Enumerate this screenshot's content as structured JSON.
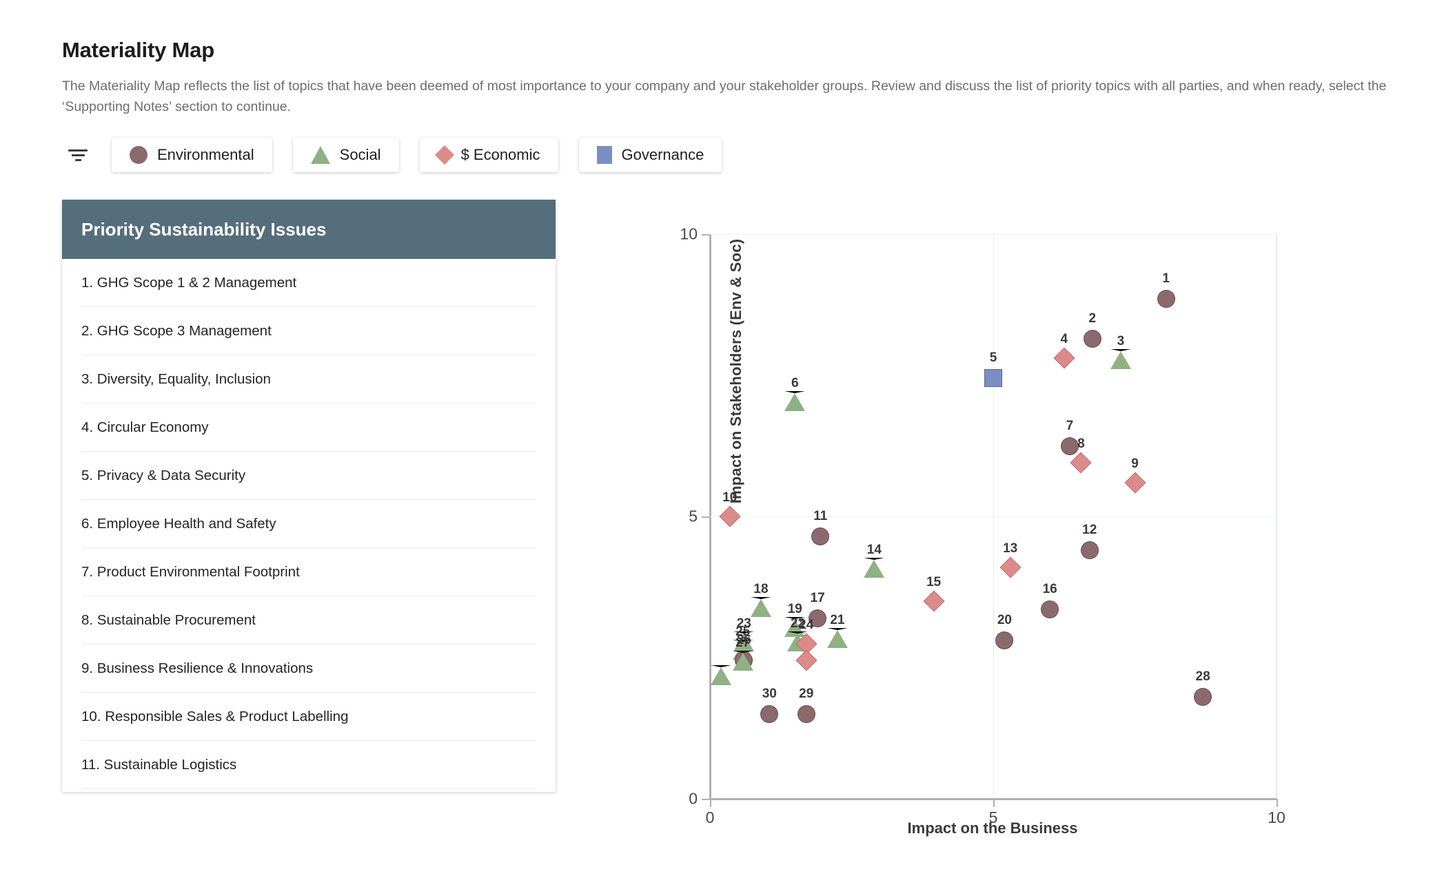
{
  "header": {
    "title": "Materiality Map",
    "description": "The Materiality Map reflects the list of topics that have been deemed of most importance to your company and your stakeholder groups. Review and discuss the list of priority topics with all parties, and when ready, select the ‘Supporting Notes’ section to continue."
  },
  "legend": {
    "filter_icon": "filter-icon",
    "items": [
      {
        "label": "Environmental",
        "marker": "circle",
        "color": "#8a6a6d"
      },
      {
        "label": "Social",
        "marker": "triangle",
        "color": "#8fb184"
      },
      {
        "label": "$ Economic",
        "marker": "diamond",
        "color": "#dd8a8a"
      },
      {
        "label": "Governance",
        "marker": "square",
        "color": "#7b8ec4"
      }
    ]
  },
  "issues_panel": {
    "header_color": "#556e7b",
    "title": "Priority Sustainability Issues",
    "items": [
      "1. GHG Scope 1 & 2 Management",
      "2. GHG Scope 3 Management",
      "3. Diversity, Equality, Inclusion",
      "4. Circular Economy",
      "5. Privacy & Data Security",
      "6. Employee Health and Safety",
      "7. Product Environmental Footprint",
      "8. Sustainable Procurement",
      "9. Business Resilience & Innovations",
      "10. Responsible Sales & Product Labelling",
      "11. Sustainable Logistics"
    ]
  },
  "chart_data": {
    "type": "scatter",
    "title": "",
    "xlabel": "Impact on the Business",
    "ylabel": "Impact on Stakeholders (Env & Soc)",
    "xlim": [
      0,
      10
    ],
    "ylim": [
      0,
      10
    ],
    "xticks": [
      "0",
      "5",
      "10"
    ],
    "xtick_values": [
      0,
      5,
      10
    ],
    "yticks": [
      "0",
      "5",
      "10"
    ],
    "ytick_values": [
      0,
      5,
      10
    ],
    "grid": true,
    "legend_position": "top",
    "categories": {
      "Environmental": {
        "marker": "circle",
        "color": "#8a6a6d"
      },
      "Social": {
        "marker": "triangle",
        "color": "#8fb184"
      },
      "Economic": {
        "marker": "diamond",
        "color": "#dd8a8a"
      },
      "Governance": {
        "marker": "square",
        "color": "#7b8ec4"
      }
    },
    "points": [
      {
        "label": "1",
        "x": 8.05,
        "y": 8.85,
        "category": "Environmental"
      },
      {
        "label": "2",
        "x": 6.75,
        "y": 8.15,
        "category": "Environmental"
      },
      {
        "label": "3",
        "x": 7.25,
        "y": 7.75,
        "category": "Social"
      },
      {
        "label": "4",
        "x": 6.25,
        "y": 7.8,
        "category": "Economic"
      },
      {
        "label": "5",
        "x": 5.0,
        "y": 7.45,
        "category": "Governance"
      },
      {
        "label": "6",
        "x": 1.5,
        "y": 7.0,
        "category": "Social"
      },
      {
        "label": "7",
        "x": 6.35,
        "y": 6.25,
        "category": "Environmental"
      },
      {
        "label": "8",
        "x": 6.55,
        "y": 5.95,
        "category": "Economic"
      },
      {
        "label": "9",
        "x": 7.5,
        "y": 5.6,
        "category": "Economic"
      },
      {
        "label": "10",
        "x": 0.35,
        "y": 5.0,
        "category": "Economic"
      },
      {
        "label": "11",
        "x": 1.95,
        "y": 4.65,
        "category": "Environmental"
      },
      {
        "label": "12",
        "x": 6.7,
        "y": 4.4,
        "category": "Environmental"
      },
      {
        "label": "13",
        "x": 5.3,
        "y": 4.1,
        "category": "Economic"
      },
      {
        "label": "14",
        "x": 2.9,
        "y": 4.05,
        "category": "Social"
      },
      {
        "label": "15",
        "x": 3.95,
        "y": 3.5,
        "category": "Economic"
      },
      {
        "label": "16",
        "x": 6.0,
        "y": 3.35,
        "category": "Environmental"
      },
      {
        "label": "17",
        "x": 1.9,
        "y": 3.2,
        "category": "Environmental"
      },
      {
        "label": "18",
        "x": 0.9,
        "y": 3.35,
        "category": "Social"
      },
      {
        "label": "19",
        "x": 1.5,
        "y": 3.0,
        "category": "Social"
      },
      {
        "label": "20",
        "x": 5.2,
        "y": 2.8,
        "category": "Environmental"
      },
      {
        "label": "21",
        "x": 2.25,
        "y": 2.8,
        "category": "Social"
      },
      {
        "label": "22",
        "x": 1.55,
        "y": 2.75,
        "category": "Social"
      },
      {
        "label": "23",
        "x": 0.6,
        "y": 2.75,
        "category": "Social"
      },
      {
        "label": "24",
        "x": 1.7,
        "y": 2.75,
        "category": "Economic"
      },
      {
        "label": "25",
        "x": 0.58,
        "y": 2.6,
        "category": "Social"
      },
      {
        "label": "26",
        "x": 0.6,
        "y": 2.45,
        "category": "Environmental"
      },
      {
        "label": "27",
        "x": 0.58,
        "y": 2.4,
        "category": "Social"
      },
      {
        "label": "24b",
        "x": 1.7,
        "y": 2.45,
        "category": "Economic"
      },
      {
        "label": "27b",
        "x": 0.2,
        "y": 2.15,
        "category": "Social"
      },
      {
        "label": "28",
        "x": 8.7,
        "y": 1.8,
        "category": "Environmental"
      },
      {
        "label": "29",
        "x": 1.7,
        "y": 1.5,
        "category": "Environmental"
      },
      {
        "label": "30",
        "x": 1.05,
        "y": 1.5,
        "category": "Environmental"
      }
    ],
    "hidden_labels": [
      "24b",
      "27b"
    ]
  }
}
